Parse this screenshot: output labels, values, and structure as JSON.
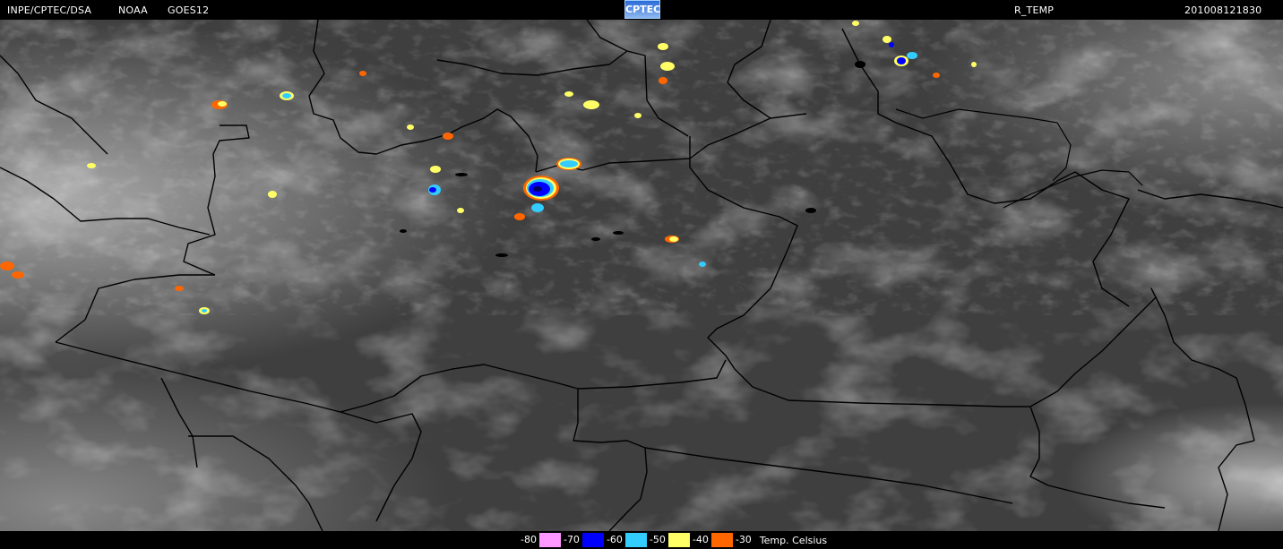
{
  "header": {
    "org": "INPE/CPTEC/DSA",
    "agency": "NOAA",
    "satellite": "GOES12",
    "logo": "CPTEC",
    "product": "R_TEMP",
    "timestamp": "201008121830"
  },
  "legend": {
    "unit": "Temp. Celsius",
    "items": [
      {
        "label": "-80",
        "color": "#ff99ff"
      },
      {
        "label": "-70",
        "color": "#0000ff"
      },
      {
        "label": "-60",
        "color": "#33ccff"
      },
      {
        "label": "-50",
        "color": "#ffff66"
      },
      {
        "label": "-40",
        "color": "#ff6600"
      },
      {
        "label": "-30",
        "color": ""
      }
    ]
  }
}
